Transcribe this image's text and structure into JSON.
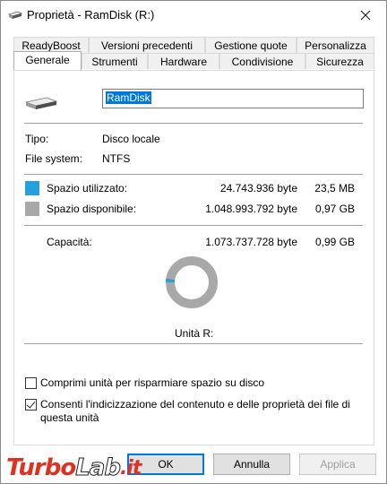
{
  "window": {
    "title": "Proprietà - RamDisk (R:)"
  },
  "tabs": {
    "row1": [
      "ReadyBoost",
      "Versioni precedenti",
      "Gestione quote",
      "Personalizza"
    ],
    "row2": [
      "Generale",
      "Strumenti",
      "Hardware",
      "Condivisione",
      "Sicurezza"
    ],
    "active": "Generale"
  },
  "drive": {
    "name": "RamDisk",
    "drive_label": "Unità R:"
  },
  "info": {
    "type_label": "Tipo:",
    "type_value": "Disco locale",
    "fs_label": "File system:",
    "fs_value": "NTFS"
  },
  "space": {
    "used_label": "Spazio utilizzato:",
    "used_bytes": "24.743.936 byte",
    "used_size": "23,5 MB",
    "used_color": "#26a0da",
    "free_label": "Spazio disponibile:",
    "free_bytes": "1.048.993.792 byte",
    "free_size": "0,97 GB",
    "free_color": "#a8a8a8",
    "capacity_label": "Capacità:",
    "capacity_bytes": "1.073.737.728 byte",
    "capacity_size": "0,99 GB",
    "used_fraction": 0.023
  },
  "options": {
    "compress_label": "Comprimi unità per risparmiare spazio su disco",
    "compress_checked": false,
    "index_line1": "Consenti l'indicizzazione del contenuto e delle proprietà dei file di",
    "index_line2": "questa unità",
    "index_checked": true
  },
  "buttons": {
    "ok": "OK",
    "cancel": "Annulla",
    "apply": "Applica"
  },
  "watermark": {
    "part1": "Turbo",
    "part2": "Lab",
    "part3": ".it"
  }
}
